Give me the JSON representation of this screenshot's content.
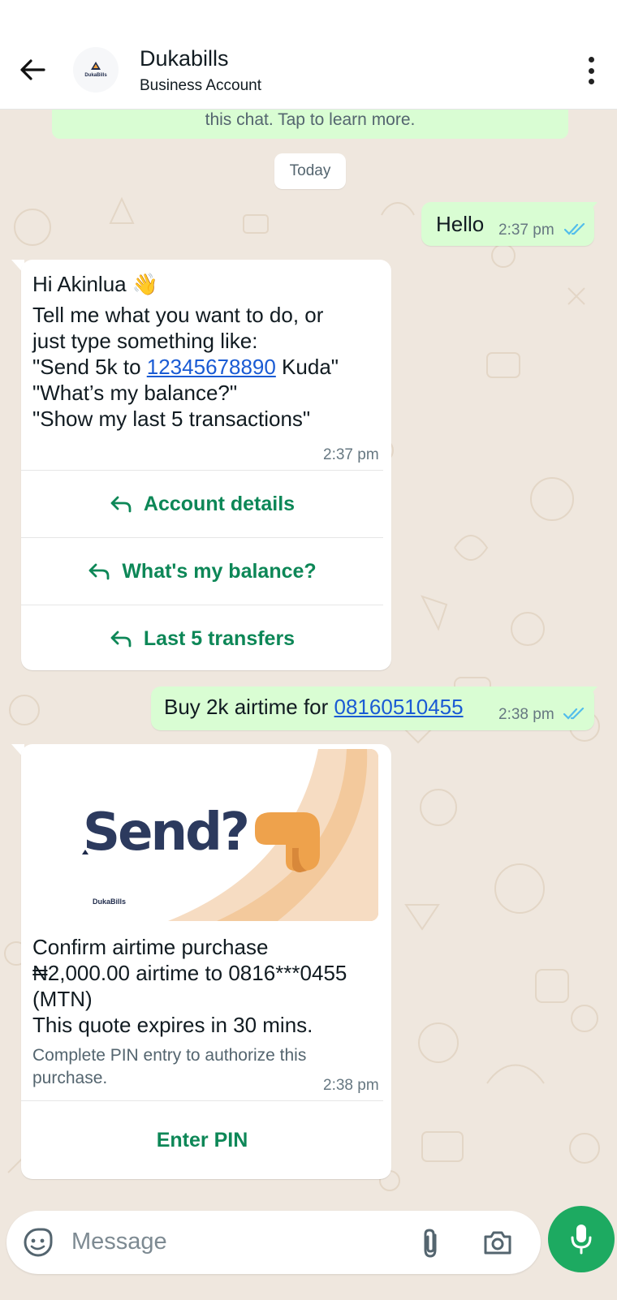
{
  "header": {
    "title": "Dukabills",
    "subtitle": "Business Account",
    "avatar_text": "DukaBills"
  },
  "chat": {
    "notice": "this chat. Tap to learn more.",
    "date_divider": "Today",
    "messages": [
      {
        "direction": "out",
        "text": "Hello",
        "time": "2:37 pm",
        "status": "read"
      },
      {
        "direction": "in",
        "lines": [
          "Hi Akinlua 👋",
          "Tell me what you want to do, or",
          "just type something like:",
          "\"Send 5k to ",
          "12345678890",
          " Kuda\"",
          "\"What’s my balance?\"",
          "\"Show my last 5 transactions\""
        ],
        "time": "2:37 pm",
        "quick_replies": [
          "Account details",
          "What's my balance?",
          "Last 5 transfers"
        ]
      },
      {
        "direction": "out",
        "text": "Buy 2k airtime for ",
        "link": "08160510455",
        "time": "2:38 pm",
        "status": "read"
      },
      {
        "direction": "in",
        "image": {
          "headline": "Send?",
          "brand": "DukaBills"
        },
        "lines": [
          "Confirm airtime purchase",
          "₦2,000.00 airtime to 0816***0455",
          "(MTN)",
          "This quote expires in 30 mins."
        ],
        "footer": [
          "Complete PIN entry to authorize this",
          "purchase."
        ],
        "time": "2:38 pm",
        "button": "Enter PIN"
      }
    ]
  },
  "composer": {
    "placeholder": "Message"
  },
  "colors": {
    "accent_green": "#0d8757",
    "outgoing_bubble": "#d9fdd3",
    "mic_button": "#1daa61",
    "link_blue": "#1a5bd4",
    "tick_blue": "#53bdeb"
  },
  "icons": [
    "back-arrow-icon",
    "more-vert-icon",
    "reply-icon",
    "double-check-icon",
    "sticker-icon",
    "attach-icon",
    "camera-icon",
    "mic-icon"
  ]
}
